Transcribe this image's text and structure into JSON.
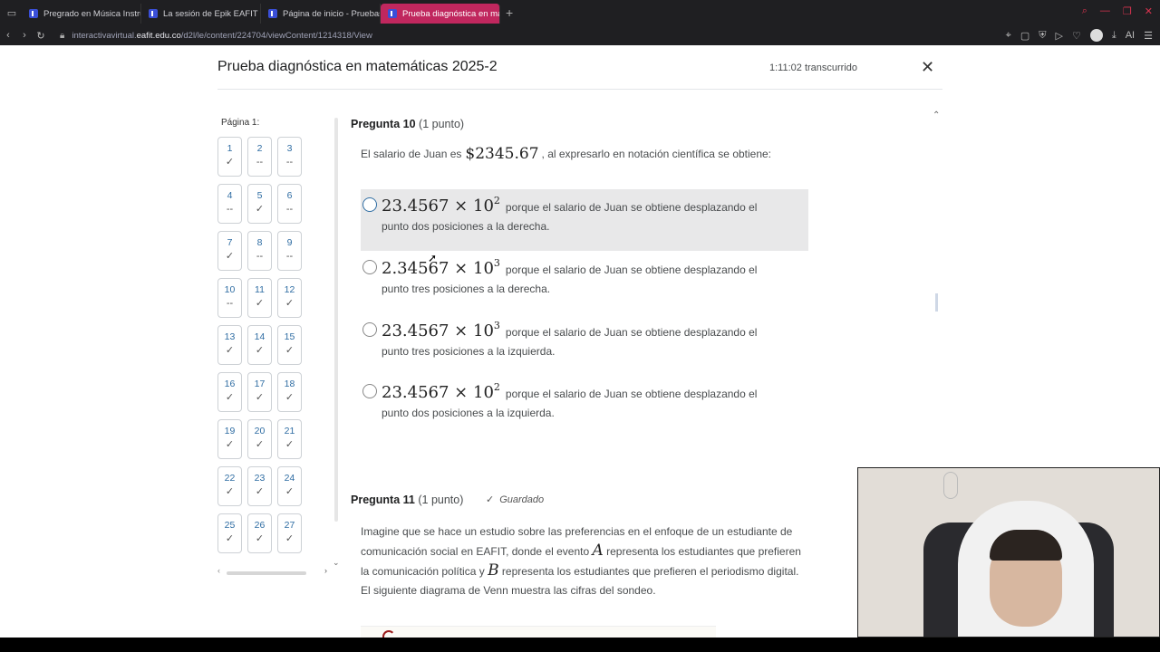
{
  "browser": {
    "tabs": [
      {
        "label": "Pregrado en Música Instru",
        "active": false
      },
      {
        "label": "La sesión de Epik EAFIT h",
        "active": false
      },
      {
        "label": "Página de inicio - Pruebas",
        "active": false
      },
      {
        "label": "Prueba diagnóstica en mat",
        "active": true
      }
    ],
    "url_prefix": "interactivavirtual.",
    "url_domain": "eafit.edu.co",
    "url_path": "/d2l/le/content/224704/viewContent/1214318/View",
    "ai_label": "AI",
    "accent_color": "#c0275e"
  },
  "quiz": {
    "title": "Prueba diagnóstica en matemáticas 2025-2",
    "elapsed": "1:11:02 transcurrido",
    "page_label": "Página 1:",
    "questions": [
      {
        "n": "1",
        "s": "✓"
      },
      {
        "n": "2",
        "s": "--"
      },
      {
        "n": "3",
        "s": "--"
      },
      {
        "n": "4",
        "s": "--"
      },
      {
        "n": "5",
        "s": "✓"
      },
      {
        "n": "6",
        "s": "--"
      },
      {
        "n": "7",
        "s": "✓"
      },
      {
        "n": "8",
        "s": "--"
      },
      {
        "n": "9",
        "s": "--"
      },
      {
        "n": "10",
        "s": "--"
      },
      {
        "n": "11",
        "s": "✓"
      },
      {
        "n": "12",
        "s": "✓"
      },
      {
        "n": "13",
        "s": "✓"
      },
      {
        "n": "14",
        "s": "✓"
      },
      {
        "n": "15",
        "s": "✓"
      },
      {
        "n": "16",
        "s": "✓"
      },
      {
        "n": "17",
        "s": "✓"
      },
      {
        "n": "18",
        "s": "✓"
      },
      {
        "n": "19",
        "s": "✓"
      },
      {
        "n": "20",
        "s": "✓"
      },
      {
        "n": "21",
        "s": "✓"
      },
      {
        "n": "22",
        "s": "✓"
      },
      {
        "n": "23",
        "s": "✓"
      },
      {
        "n": "24",
        "s": "✓"
      },
      {
        "n": "25",
        "s": "✓"
      },
      {
        "n": "26",
        "s": "✓"
      },
      {
        "n": "27",
        "s": "✓"
      }
    ]
  },
  "q10": {
    "label": "Pregunta 10",
    "points": "(1 punto)",
    "text_before": "El salario de Juan es",
    "amount": "$2345.67",
    "text_after": ", al expresarlo en notación científica se obtiene:",
    "options": [
      {
        "mantissa": "23.4567",
        "exp": "2",
        "rest": "porque el salario de Juan se obtiene desplazando el",
        "line2": "punto dos posiciones a la derecha."
      },
      {
        "mantissa": "2.34567",
        "exp": "3",
        "rest": "porque el salario de Juan se obtiene desplazando el",
        "line2": "punto tres posiciones a la derecha."
      },
      {
        "mantissa": "23.4567",
        "exp": "3",
        "rest": "porque el salario de Juan se obtiene desplazando el",
        "line2": "punto tres posiciones a la izquierda."
      },
      {
        "mantissa": "23.4567",
        "exp": "2",
        "rest": "porque el salario de Juan se obtiene desplazando el",
        "line2": "punto dos posiciones a la izquierda."
      }
    ]
  },
  "q11": {
    "label": "Pregunta 11",
    "points": "(1 punto)",
    "saved": "Guardado",
    "t1": "Imagine que se hace un estudio sobre las preferencias en el enfoque de un estudiante de comunicación social en EAFIT, donde el evento",
    "var_a": "A",
    "t2": "representa los estudiantes que prefieren la comunicación política y",
    "var_b": "B",
    "t3": "representa los estudiantes que prefieren el periodismo digital. El siguiente diagrama de Venn muestra las cifras del sondeo."
  },
  "math_symbols": {
    "times": "×",
    "ten": "10"
  }
}
